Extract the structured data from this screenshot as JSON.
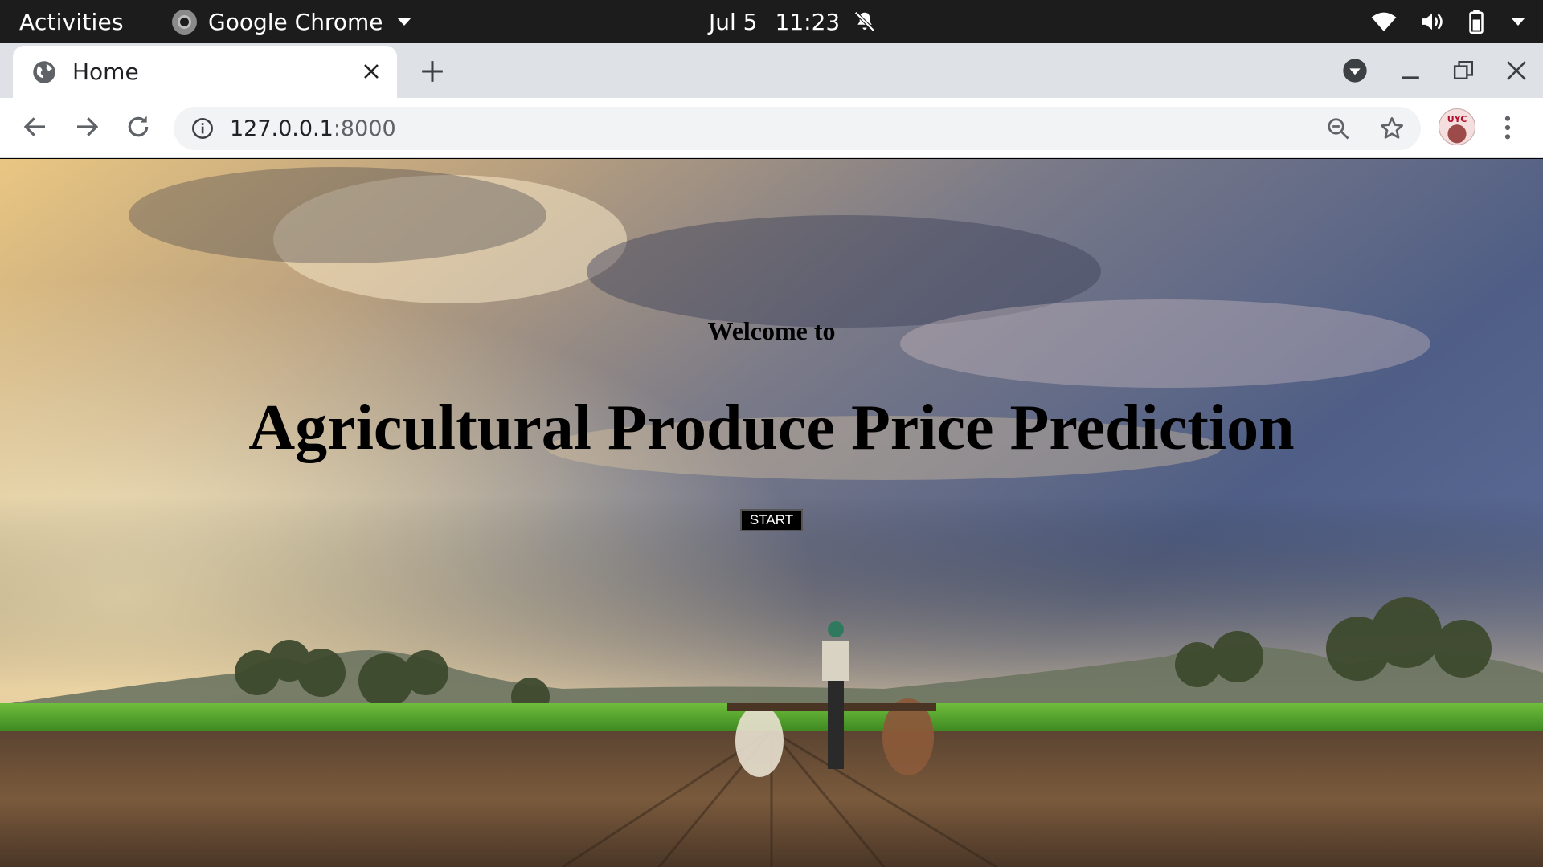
{
  "topbar": {
    "activities": "Activities",
    "app_name": "Google Chrome",
    "date": "Jul 5",
    "time": "11:23"
  },
  "browser": {
    "tab_title": "Home",
    "url_host": "127.0.0.1",
    "url_port": ":8000"
  },
  "page": {
    "welcome": "Welcome to",
    "title": "Agricultural Produce Price Prediction",
    "start_label": "START"
  },
  "avatar_text": "UYC",
  "icons": {
    "notifications": "bell-off-icon",
    "wifi": "wifi-icon",
    "volume": "volume-icon",
    "battery": "battery-icon",
    "globe": "globe-icon",
    "info": "info-icon",
    "zoom": "zoom-out-icon",
    "bookmark": "star-icon"
  },
  "colors": {
    "topbar_bg": "#1c1c1c",
    "tabstrip_bg": "#dee1e6",
    "omnibox_bg": "#f1f3f4",
    "button_bg": "#000000",
    "title_text": "#000000"
  }
}
